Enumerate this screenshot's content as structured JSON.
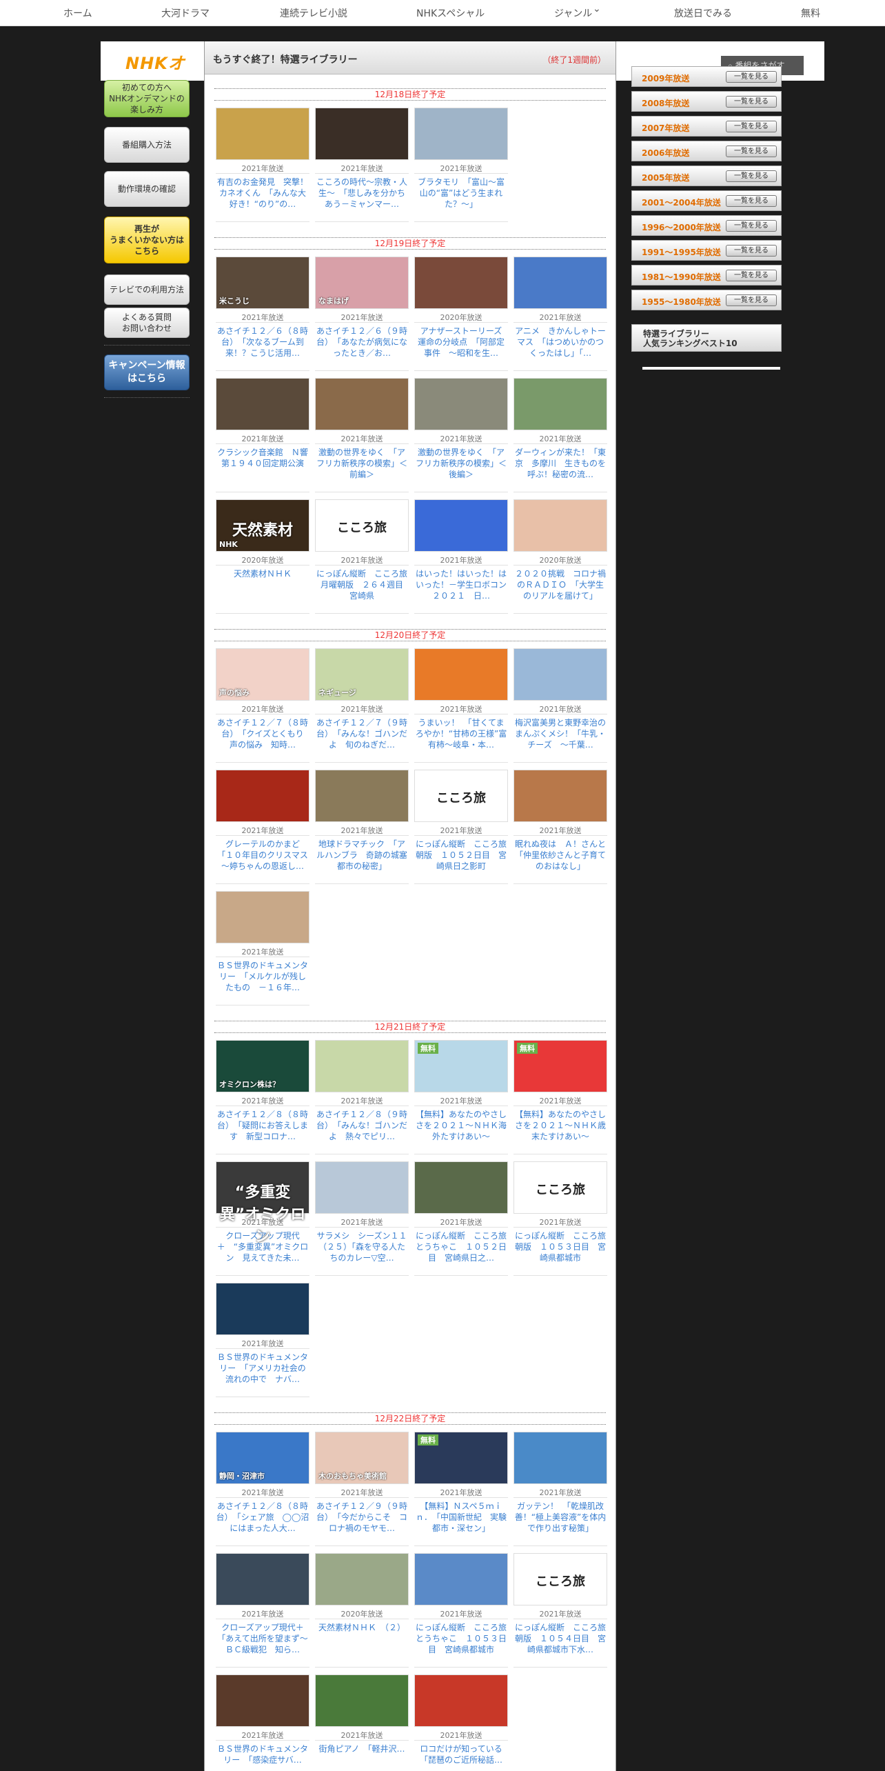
{
  "topnav": [
    "ホーム",
    "大河ドラマ",
    "連続テレビ小説",
    "NHKスペシャル",
    "ジャンル",
    "放送日でみる",
    "無料"
  ],
  "header": {
    "logo": "NHKオ",
    "search": "番組をさがす"
  },
  "left_menu": [
    {
      "label": "初めての方へ\nNHKオンデマンドの\n楽しみ方"
    },
    {
      "label": "番組購入方法"
    },
    {
      "label": "動作環境の確認"
    },
    {
      "label": "再生が\nうまくいかない方は\nこちら"
    },
    {
      "label": "テレビでの利用方法"
    },
    {
      "label": "よくある質問\nお問い合わせ"
    },
    {
      "label": "キャンペーン情報\nはこちら"
    }
  ],
  "panel": {
    "title": "もうすぐ終了！特選ライブラリー",
    "subtitle": "（終了1週間前）"
  },
  "sections": [
    {
      "heading": "12月18日終了予定",
      "items": [
        {
          "year": "2021年放送",
          "title": "有吉のお金発見　突撃！カネオくん　「みんな大好き！“のり”の…",
          "color": "#c9a24b",
          "cap": ""
        },
        {
          "year": "2021年放送",
          "title": "こころの時代～宗教・人生～　「悲しみを分かちあう－ミャンマー…",
          "color": "#3a2e26",
          "cap": ""
        },
        {
          "year": "2021年放送",
          "title": "ブラタモリ　「富山～富山の“富”はどう生まれた？～」",
          "color": "#9fb4c8",
          "cap": ""
        }
      ]
    },
    {
      "heading": "12月19日終了予定",
      "items": [
        {
          "year": "2021年放送",
          "title": "あさイチ１２／６（８時台）　「次なるブーム到来！？こうじ活用…",
          "color": "#5b4a3a",
          "cap": "米こうじ"
        },
        {
          "year": "2021年放送",
          "title": "あさイチ１２／６（９時台）　「あなたが病気になったとき／お…",
          "color": "#d8a0a8",
          "cap": "なまはげ"
        },
        {
          "year": "2020年放送",
          "title": "アナザーストーリーズ　運命の分岐点　「阿部定事件　～昭和を生…",
          "color": "#7a4a3a",
          "cap": ""
        },
        {
          "year": "2021年放送",
          "title": "アニメ　きかんしゃトーマス　「はつめいかのつくったはし」「…",
          "color": "#4a7ac8",
          "cap": ""
        },
        {
          "year": "2021年放送",
          "title": "クラシック音楽館　Ｎ響第１９４０回定期公演",
          "color": "#5a4a3a",
          "cap": ""
        },
        {
          "year": "2021年放送",
          "title": "激動の世界をゆく　「アフリカ新秩序の模索」＜前編＞",
          "color": "#8a6a4a",
          "cap": ""
        },
        {
          "year": "2021年放送",
          "title": "激動の世界をゆく　「アフリカ新秩序の模索」＜後編＞",
          "color": "#8a8a7a",
          "cap": ""
        },
        {
          "year": "2021年放送",
          "title": "ダーウィンが来た！「東京　多摩川　生きものを呼ぶ！秘密の流…",
          "color": "#7a9a6a",
          "cap": ""
        },
        {
          "year": "2020年放送",
          "title": "天然素材ＮＨＫ",
          "color": "#3a2a1a",
          "cap": "NHK",
          "big": "天然素材"
        },
        {
          "year": "2021年放送",
          "title": "にっぽん縦断　こころ旅　月曜朝版　２６４週目　宮崎県",
          "color": "#ffffff",
          "cap": "",
          "big": "こころ旅"
        },
        {
          "year": "2021年放送",
          "title": "はいった！はいった！はいった！－学生ロボコン２０２１　日…",
          "color": "#3a6ad8",
          "cap": ""
        },
        {
          "year": "2020年放送",
          "title": "２０２０挑戦　コロナ禍のＲＡＤＩＯ　「大学生のリアルを届けて」",
          "color": "#e8c0a8",
          "cap": ""
        }
      ]
    },
    {
      "heading": "12月20日終了予定",
      "items": [
        {
          "year": "2021年放送",
          "title": "あさイチ１２／７（８時台）　「クイズとくもり　声の悩み　知時…",
          "color": "#f2d2c8",
          "cap": "声の悩み"
        },
        {
          "year": "2021年放送",
          "title": "あさイチ１２／７（９時台）　「みんな！ゴハンだよ　旬のねぎだ…",
          "color": "#c8d8a8",
          "cap": "ネギュージ"
        },
        {
          "year": "2021年放送",
          "title": "うまいッ！　「甘くてまろやか！“甘柿の王様”富有柿～岐阜・本…",
          "color": "#e87a28",
          "cap": ""
        },
        {
          "year": "2021年放送",
          "title": "梅沢富美男と東野幸治のまんぷくメシ！「牛乳・チーズ　～千葉…",
          "color": "#9ab8d8",
          "cap": ""
        },
        {
          "year": "2021年放送",
          "title": "グレーテルのかまど　「１０年目のクリスマス～婷ちゃんの恩返し…",
          "color": "#a82818",
          "cap": ""
        },
        {
          "year": "2021年放送",
          "title": "地球ドラマチック　「アルハンブラ　奇跡の城塞都市の秘密」",
          "color": "#8a7a5a",
          "cap": ""
        },
        {
          "year": "2021年放送",
          "title": "にっぽん縦断　こころ旅　朝版　１０５２日目　宮崎県日之影町",
          "color": "#ffffff",
          "cap": "",
          "big": "こころ旅"
        },
        {
          "year": "2021年放送",
          "title": "眠れぬ夜は　Ａ！さんと　「仲里依紗さんと子育てのおはなし」",
          "color": "#b8784a",
          "cap": ""
        },
        {
          "year": "2021年放送",
          "title": "ＢＳ世界のドキュメンタリー　「メルケルが残したもの　－１６年…",
          "color": "#c8a888",
          "cap": ""
        }
      ]
    },
    {
      "heading": "12月21日終了予定",
      "items": [
        {
          "year": "2021年放送",
          "title": "あさイチ１２／８（８時台）　「疑問にお答えします　新型コロナ…",
          "color": "#1a4a3a",
          "cap": "オミクロン株は？"
        },
        {
          "year": "2021年放送",
          "title": "あさイチ１２／８（９時台）　「みんな！ゴハンだよ　熱々でピリ…",
          "color": "#c8d8a8",
          "cap": ""
        },
        {
          "year": "2021年放送",
          "title": "【無料】あなたのやさしさを２０２１～ＮＨＫ海外たすけあい～",
          "color": "#b8d8e8",
          "cap": "無料"
        },
        {
          "year": "2021年放送",
          "title": "【無料】あなたのやさしさを２０２１～ＮＨＫ歳末たすけあい～",
          "color": "#e83838",
          "cap": "無料"
        },
        {
          "year": "2021年放送",
          "title": "クローズアップ現代＋　“多重変異”オミクロン　見えてきた未…",
          "color": "#3a3a3a",
          "cap": "",
          "big": "“多重変異”オミクロン"
        },
        {
          "year": "2021年放送",
          "title": "サラメシ　シーズン１１　（２５）「森を守る人たちのカレー▽空…",
          "color": "#b8c8d8",
          "cap": ""
        },
        {
          "year": "2021年放送",
          "title": "にっぽん縦断　こころ旅　とうちゃこ　１０５２日目　宮崎県日之…",
          "color": "#5a6a4a",
          "cap": ""
        },
        {
          "year": "2021年放送",
          "title": "にっぽん縦断　こころ旅　朝版　１０５３日目　宮崎県都城市",
          "color": "#ffffff",
          "cap": "",
          "big": "こころ旅"
        },
        {
          "year": "2021年放送",
          "title": "ＢＳ世界のドキュメンタリー　「アメリカ社会の流れの中で　ナバ…",
          "color": "#1a3a5a",
          "cap": ""
        }
      ]
    },
    {
      "heading": "12月22日終了予定",
      "items": [
        {
          "year": "2021年放送",
          "title": "あさイチ１２／８（８時台）　「シェア旅　◯◯沼にはまった人大…",
          "color": "#3a78c8",
          "cap": "静岡・沼津市"
        },
        {
          "year": "2021年放送",
          "title": "あさイチ１２／９（９時台）　「今だからこそ　コロナ禍のモヤモ…",
          "color": "#e8c8b8",
          "cap": "木のおもちゃ美術館"
        },
        {
          "year": "2021年放送",
          "title": "【無料】Ｎスペ５ｍｉｎ．　「中国新世紀　実験都市・深セン」",
          "color": "#2a3a5a",
          "cap": "無料"
        },
        {
          "year": "2021年放送",
          "title": "ガッテン！　「乾燥肌改善！“極上美容液”を体内で作り出す秘策」",
          "color": "#4a8ac8",
          "cap": ""
        },
        {
          "year": "2021年放送",
          "title": "クローズアップ現代＋　「あえて出所を望まず～ＢＣ級戦犯　知ら…",
          "color": "#3a4a5a",
          "cap": ""
        },
        {
          "year": "2020年放送",
          "title": "天然素材ＮＨＫ　（２）",
          "color": "#9aa888",
          "cap": ""
        },
        {
          "year": "2021年放送",
          "title": "にっぽん縦断　こころ旅　とうちゃこ　１０５３日目　宮崎県都城市",
          "color": "#5a8ac8",
          "cap": ""
        },
        {
          "year": "2021年放送",
          "title": "にっぽん縦断　こころ旅　朝版　１０５４日目　宮崎県都城市下水…",
          "color": "#ffffff",
          "cap": "",
          "big": "こころ旅"
        },
        {
          "year": "2021年放送",
          "title": "ＢＳ世界のドキュメンタリー　「感染症サバ…",
          "color": "#5a3a2a",
          "cap": ""
        },
        {
          "year": "2021年放送",
          "title": "街角ピアノ　「軽井沢…",
          "color": "#4a7a3a",
          "cap": ""
        },
        {
          "year": "2021年放送",
          "title": "ロコだけが知っている　「琵琶のご近所秘話…",
          "color": "#c83828",
          "cap": ""
        }
      ]
    }
  ],
  "year_list": [
    {
      "label": "2009年放送",
      "view": "一覧を見る"
    },
    {
      "label": "2008年放送",
      "view": "一覧を見る"
    },
    {
      "label": "2007年放送",
      "view": "一覧を見る"
    },
    {
      "label": "2006年放送",
      "view": "一覧を見る"
    },
    {
      "label": "2005年放送",
      "view": "一覧を見る"
    },
    {
      "label": "2001～2004年放送",
      "view": "一覧を見る"
    },
    {
      "label": "1996～2000年放送",
      "view": "一覧を見る"
    },
    {
      "label": "1991～1995年放送",
      "view": "一覧を見る"
    },
    {
      "label": "1981～1990年放送",
      "view": "一覧を見る"
    },
    {
      "label": "1955～1980年放送",
      "view": "一覧を見る"
    }
  ],
  "ranking": {
    "title": "特選ライブラリー\n人気ランキングベスト10"
  }
}
